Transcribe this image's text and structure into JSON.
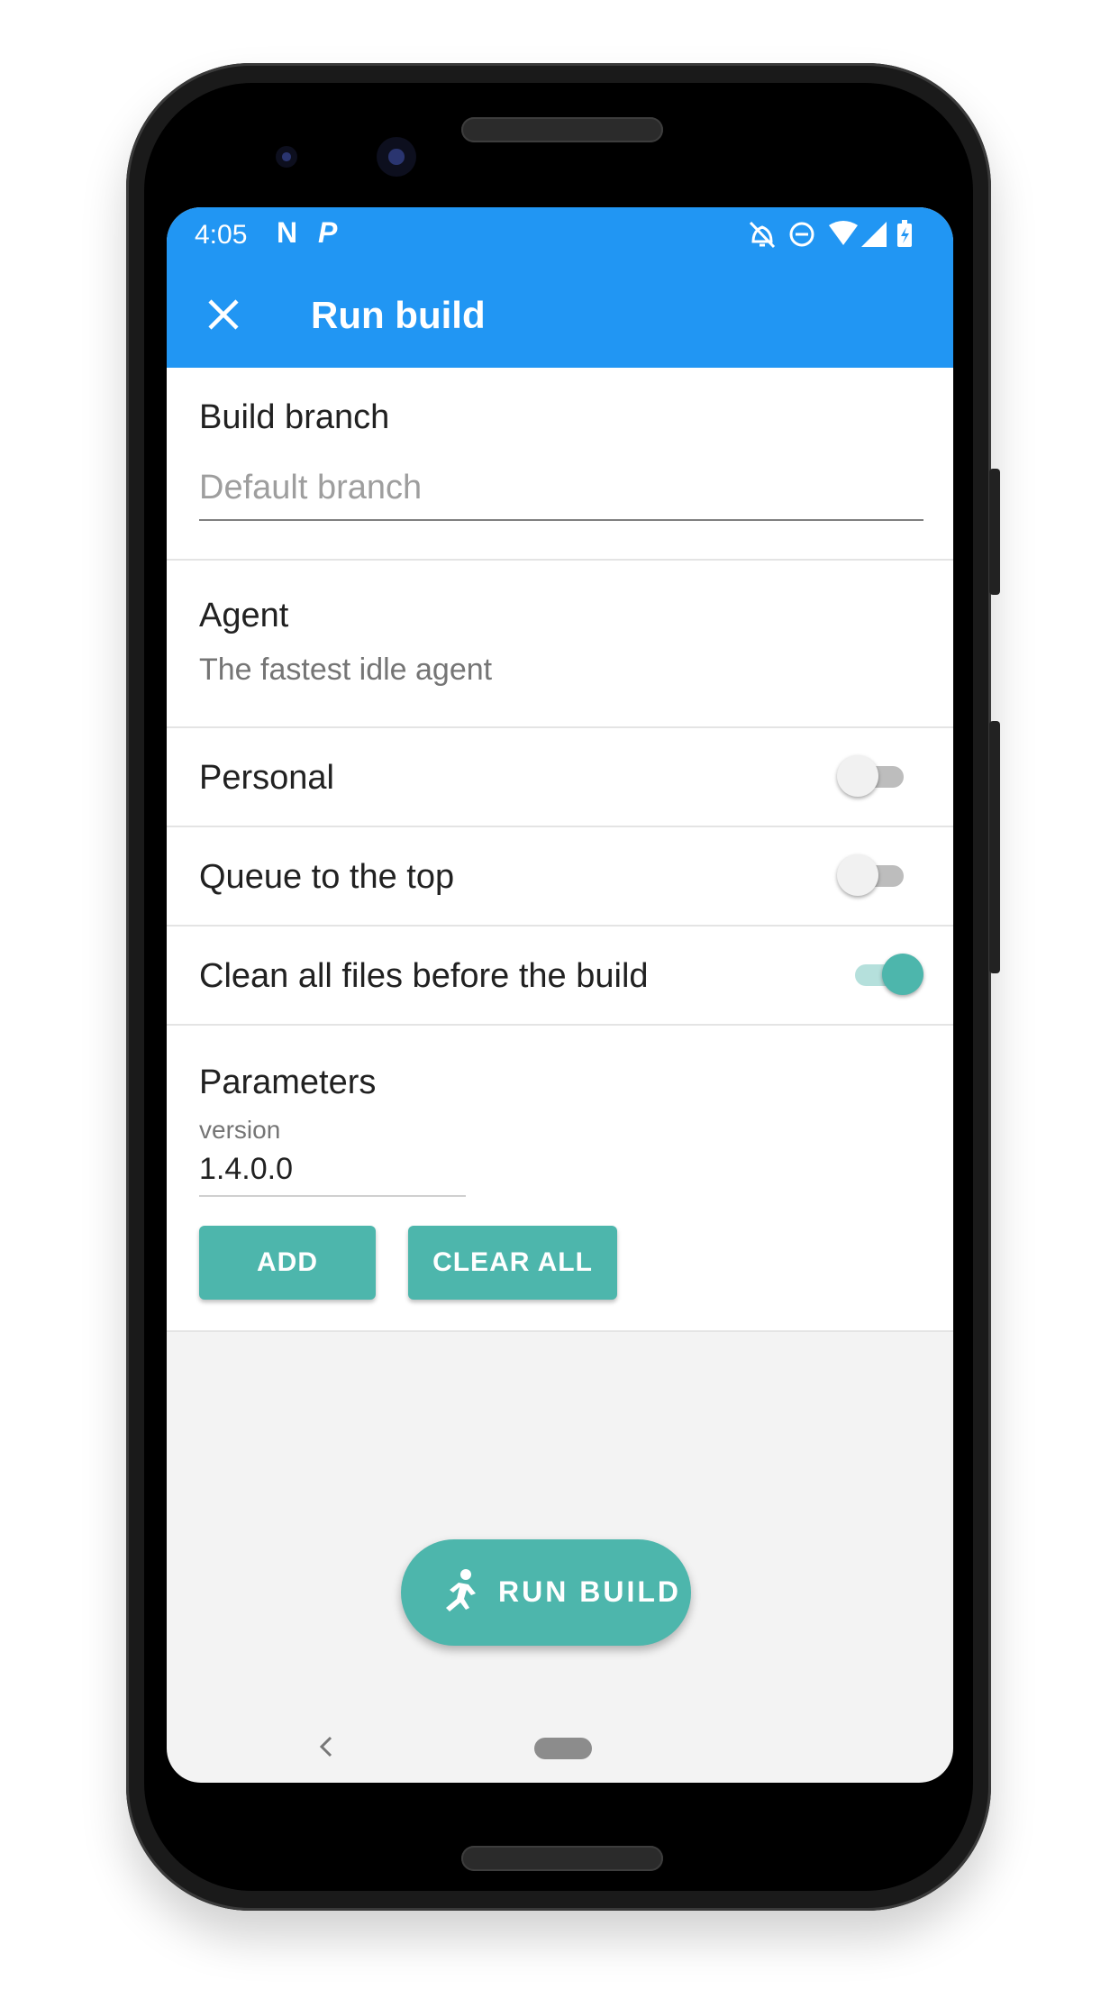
{
  "status_bar": {
    "time": "4:05",
    "notif_icon_1": "N",
    "notif_icon_2": "P",
    "icons": [
      "notifications-off-icon",
      "do-not-disturb-icon",
      "wifi-icon",
      "cell-signal-icon",
      "battery-charging-icon"
    ]
  },
  "app_bar": {
    "title": "Run build",
    "close_icon": "close-icon",
    "background": "#2196f3"
  },
  "form": {
    "build_branch": {
      "label": "Build branch",
      "placeholder": "Default branch",
      "value": ""
    },
    "agent": {
      "label": "Agent",
      "value": "The fastest idle agent"
    },
    "toggles": [
      {
        "label": "Personal",
        "on": false
      },
      {
        "label": "Queue to the top",
        "on": false
      },
      {
        "label": "Clean all files before the build",
        "on": true
      }
    ],
    "parameters": {
      "label": "Parameters",
      "param_name": "version",
      "param_value": "1.4.0.0",
      "add_label": "ADD",
      "clear_all_label": "CLEAR ALL"
    }
  },
  "fab": {
    "label": "RUN BUILD",
    "icon": "running-person-icon"
  },
  "accent_color": "#4db6ac"
}
